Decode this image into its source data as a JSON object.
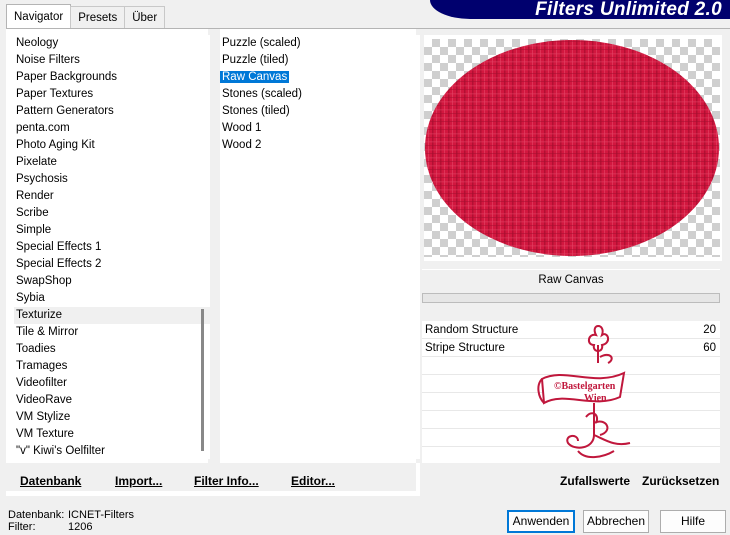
{
  "banner": {
    "title": "Filters Unlimited 2.0"
  },
  "tabs": [
    "Navigator",
    "Presets",
    "Über"
  ],
  "categories": [
    "Neology",
    "Noise Filters",
    "Paper Backgrounds",
    "Paper Textures",
    "Pattern Generators",
    "penta.com",
    "Photo Aging Kit",
    "Pixelate",
    "Psychosis",
    "Render",
    "Scribe",
    "Simple",
    "Special Effects 1",
    "Special Effects 2",
    "SwapShop",
    "Sybia",
    "Texturize",
    "Tile & Mirror",
    "Toadies",
    "Tramages",
    "Videofilter",
    "VideoRave",
    "VM Stylize",
    "VM Texture",
    "\"v\" Kiwi's Oelfilter"
  ],
  "selected_category": "Texturize",
  "filters": [
    "Puzzle (scaled)",
    "Puzzle (tiled)",
    "Raw Canvas",
    "Stones (scaled)",
    "Stones (tiled)",
    "Wood 1",
    "Wood 2"
  ],
  "selected_filter": "Raw Canvas",
  "left_buttons": {
    "datenbank": "Datenbank",
    "import": "Import...",
    "filter_info": "Filter Info...",
    "editor": "Editor..."
  },
  "right_buttons": {
    "random": "Zufallswerte",
    "reset": "Zurücksetzen"
  },
  "current_filter_name": "Raw Canvas",
  "params": [
    {
      "name": "Random Structure",
      "value": "20"
    },
    {
      "name": "Stripe Structure",
      "value": "60"
    }
  ],
  "watermark": {
    "line1": "©Bastelgarten",
    "line2": "Wien"
  },
  "info": {
    "datenbank_label": "Datenbank:",
    "datenbank_value": "ICNET-Filters",
    "filter_label": "Filter:",
    "filter_value": "1206"
  },
  "dialog_buttons": {
    "apply": "Anwenden",
    "cancel": "Abbrechen",
    "help": "Hilfe"
  },
  "colors": {
    "accent": "#0078d7",
    "banner": "#00006e",
    "preview_fill": "#d2173f"
  }
}
